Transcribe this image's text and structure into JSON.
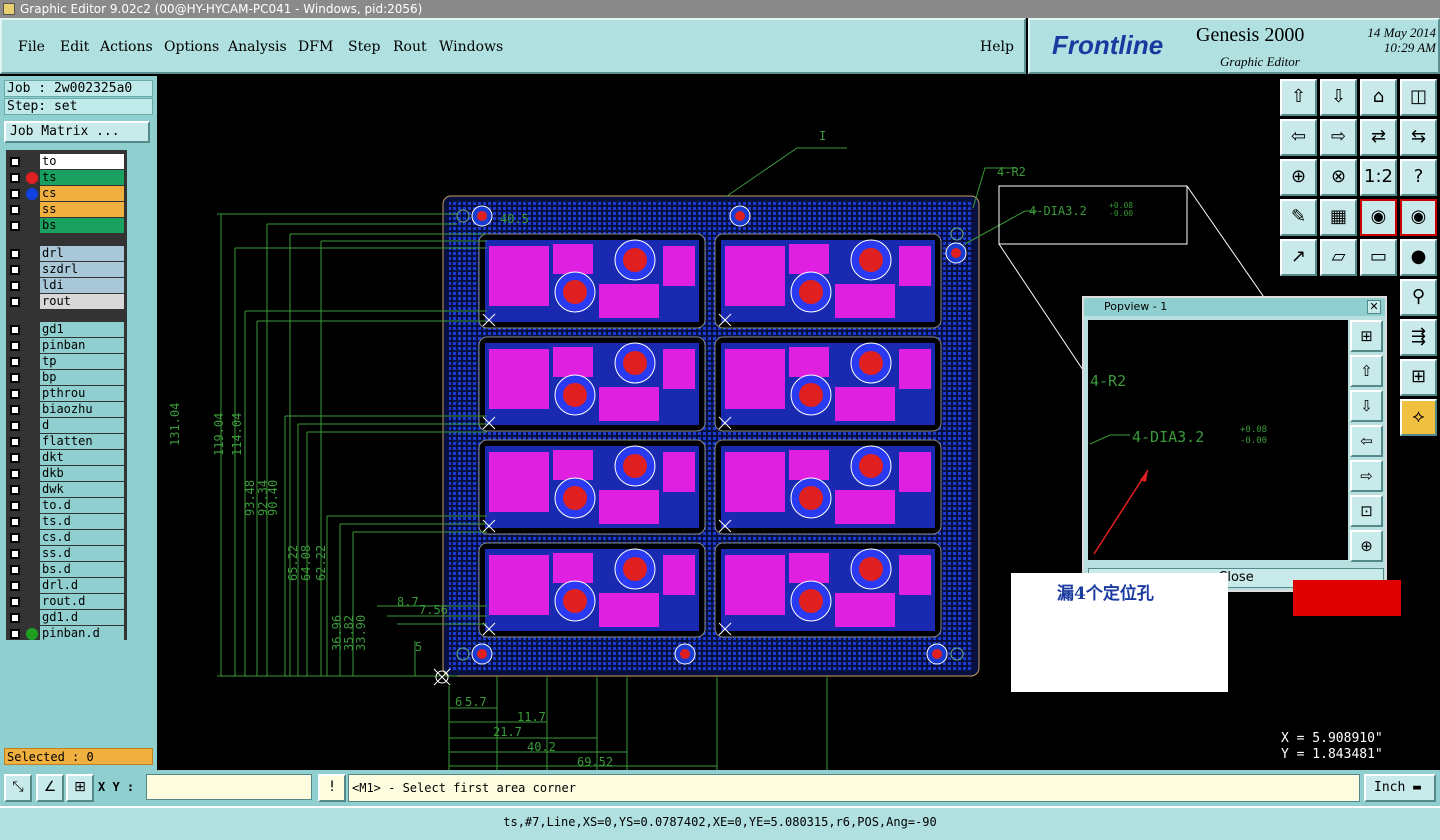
{
  "window": {
    "title": "Graphic Editor 9.02c2 (00@HY-HYCAM-PC041 - Windows, pid:2056)"
  },
  "menu": {
    "items": [
      "File",
      "Edit",
      "Actions",
      "Options",
      "Analysis",
      "DFM",
      "Step",
      "Rout",
      "Windows"
    ],
    "help": "Help"
  },
  "brand": {
    "logo": "Frontline",
    "product": "Genesis 2000",
    "subtitle": "Graphic Editor",
    "date": "14 May 2014",
    "time": "10:29 AM"
  },
  "left_panel": {
    "job": "Job : 2w002325a0",
    "step": "Step: set",
    "job_matrix": "Job Matrix ...",
    "layers": [
      {
        "name": "to",
        "bg": "#ffffff"
      },
      {
        "name": "ts",
        "bg": "#1aa060",
        "dot": "#e02020"
      },
      {
        "name": "cs",
        "bg": "#f0b040",
        "dot": "#1040e0"
      },
      {
        "name": "ss",
        "bg": "#f0b040"
      },
      {
        "name": "bs",
        "bg": "#1aa060"
      },
      {
        "name": "drl",
        "bg": "#a8c8d8"
      },
      {
        "name": "szdrl",
        "bg": "#a8c8d8"
      },
      {
        "name": "ldi",
        "bg": "#a8c8d8"
      },
      {
        "name": "rout",
        "bg": "#d8d8d8"
      },
      {
        "name": "gd1",
        "bg": "#8fcfcf"
      },
      {
        "name": "pinban",
        "bg": "#8fcfcf"
      },
      {
        "name": "tp",
        "bg": "#8fcfcf"
      },
      {
        "name": "bp",
        "bg": "#8fcfcf"
      },
      {
        "name": "pthrou",
        "bg": "#8fcfcf"
      },
      {
        "name": "biaozhu",
        "bg": "#8fcfcf"
      },
      {
        "name": "d",
        "bg": "#8fcfcf"
      },
      {
        "name": "flatten",
        "bg": "#8fcfcf"
      },
      {
        "name": "dkt",
        "bg": "#8fcfcf"
      },
      {
        "name": "dkb",
        "bg": "#8fcfcf"
      },
      {
        "name": "dwk",
        "bg": "#8fcfcf"
      },
      {
        "name": "to.d",
        "bg": "#8fcfcf"
      },
      {
        "name": "ts.d",
        "bg": "#8fcfcf"
      },
      {
        "name": "cs.d",
        "bg": "#8fcfcf"
      },
      {
        "name": "ss.d",
        "bg": "#8fcfcf"
      },
      {
        "name": "bs.d",
        "bg": "#8fcfcf"
      },
      {
        "name": "drl.d",
        "bg": "#8fcfcf"
      },
      {
        "name": "rout.d",
        "bg": "#8fcfcf"
      },
      {
        "name": "gd1.d",
        "bg": "#8fcfcf"
      },
      {
        "name": "pinban.d",
        "bg": "#8fcfcf",
        "dot": "#20a020"
      }
    ],
    "selected": "Selected : 0"
  },
  "canvas": {
    "label_I": "I",
    "label_r2": "4-R2",
    "label_dia": "4-DIA3.2",
    "tol_plus": "+0.08",
    "tol_minus": "-0.00",
    "dim_left": [
      "131.04",
      "119.04",
      "114.04",
      "93.48",
      "92.34",
      "90.40",
      "65.22",
      "64.08",
      "62.22",
      "36.96",
      "35.82",
      "33.90",
      "8.7",
      "7.56",
      "5"
    ],
    "dim_bottom": [
      "5.7",
      "11.7",
      "21.7",
      "40.2",
      "69.52"
    ],
    "dim_top": "40.5",
    "dim_small": "6"
  },
  "popview": {
    "title": "Popview - 1",
    "r2": "4-R2",
    "dia": "4-DIA3.2",
    "close": "Close"
  },
  "annotation": {
    "text": "漏4个定位孔"
  },
  "coords": {
    "x": "X = 5.908910\"",
    "y": "Y = 1.843481\""
  },
  "bottom": {
    "xy_label": "X Y :",
    "xy_value": "",
    "prompt": "<M1> - Select first area corner",
    "units": "Inch"
  },
  "status": {
    "text": "ts,#7,Line,XS=0,YS=0.0787402,XE=0,YE=5.080315,r6,POS,Ang=-90"
  }
}
